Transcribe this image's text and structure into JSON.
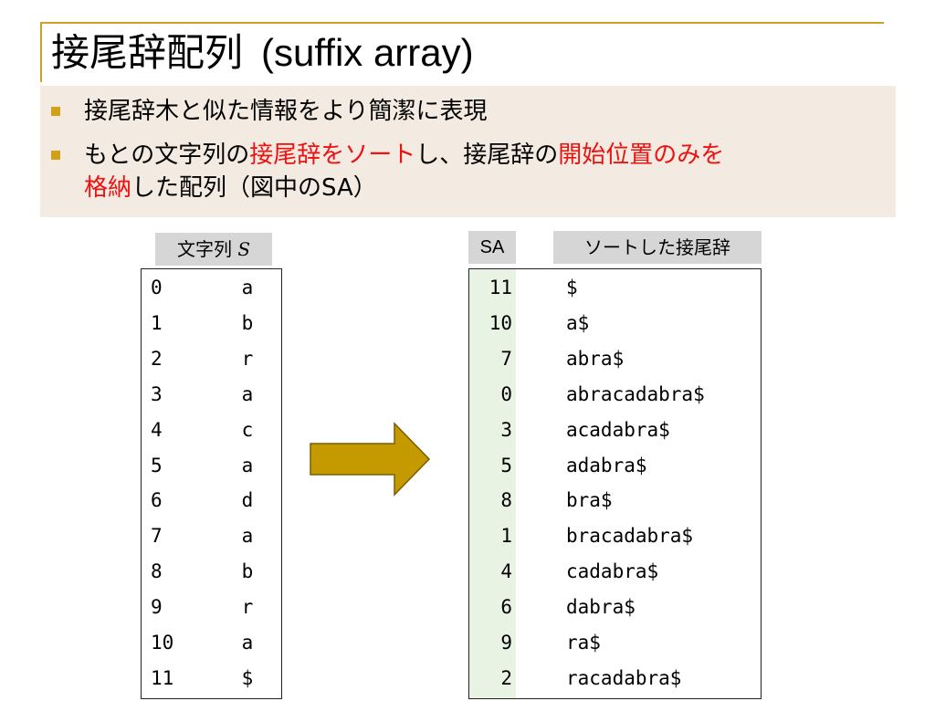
{
  "title": {
    "jp": "接尾辞配列",
    "en": "(suffix array)"
  },
  "bullets": {
    "item1": "接尾辞木と似た情報をより簡潔に表現",
    "item2": {
      "p1": "もとの文字列の",
      "p2": "接尾辞をソート",
      "p3": "し、接尾辞の",
      "p4": "開始位置のみを",
      "line2_p1": "格納",
      "line2_p2": "した配列（図中のSA）"
    }
  },
  "headers": {
    "string_label": "文字列",
    "string_var": "S",
    "sa": "SA",
    "sorted": "ソートした接尾辞"
  },
  "string_table": [
    {
      "i": "0",
      "c": "a"
    },
    {
      "i": "1",
      "c": "b"
    },
    {
      "i": "2",
      "c": "r"
    },
    {
      "i": "3",
      "c": "a"
    },
    {
      "i": "4",
      "c": "c"
    },
    {
      "i": "5",
      "c": "a"
    },
    {
      "i": "6",
      "c": "d"
    },
    {
      "i": "7",
      "c": "a"
    },
    {
      "i": "8",
      "c": "b"
    },
    {
      "i": "9",
      "c": "r"
    },
    {
      "i": "10",
      "c": "a"
    },
    {
      "i": "11",
      "c": "$"
    }
  ],
  "sa_table": [
    {
      "sa": "11",
      "suffix": "$"
    },
    {
      "sa": "10",
      "suffix": "a$"
    },
    {
      "sa": "7",
      "suffix": "abra$"
    },
    {
      "sa": "0",
      "suffix": "abracadabra$"
    },
    {
      "sa": "3",
      "suffix": "acadabra$"
    },
    {
      "sa": "5",
      "suffix": "adabra$"
    },
    {
      "sa": "8",
      "suffix": "bra$"
    },
    {
      "sa": "1",
      "suffix": "bracadabra$"
    },
    {
      "sa": "4",
      "suffix": "cadabra$"
    },
    {
      "sa": "6",
      "suffix": "dabra$"
    },
    {
      "sa": "9",
      "suffix": "ra$"
    },
    {
      "sa": "2",
      "suffix": "racadabra$"
    }
  ],
  "colors": {
    "accent": "#c9a227",
    "bullet": "#d4a017",
    "highlight": "#ee1111",
    "arrow_fill": "#c59a00",
    "arrow_stroke": "#7a5f00",
    "sa_column_bg": "#e9f3e4",
    "bullet_box_bg": "#f3ebe1",
    "header_bg": "#d6d6d6"
  }
}
